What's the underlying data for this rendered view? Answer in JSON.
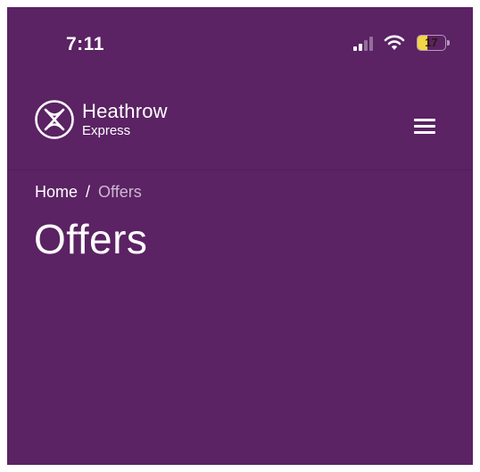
{
  "status_bar": {
    "time": "7:11",
    "battery_level": "17",
    "battery_fraction": 0.17,
    "signal_bars_active": 2,
    "signal_bars_total": 4
  },
  "header": {
    "logo_title": "Heathrow",
    "logo_subtitle": "Express",
    "menu_icon": "hamburger-menu-icon"
  },
  "breadcrumb": {
    "home_label": "Home",
    "separator": "/",
    "current_label": "Offers"
  },
  "page": {
    "title": "Offers"
  },
  "colors": {
    "background": "#5b2264",
    "text": "#ffffff",
    "battery": "#f3d548"
  }
}
